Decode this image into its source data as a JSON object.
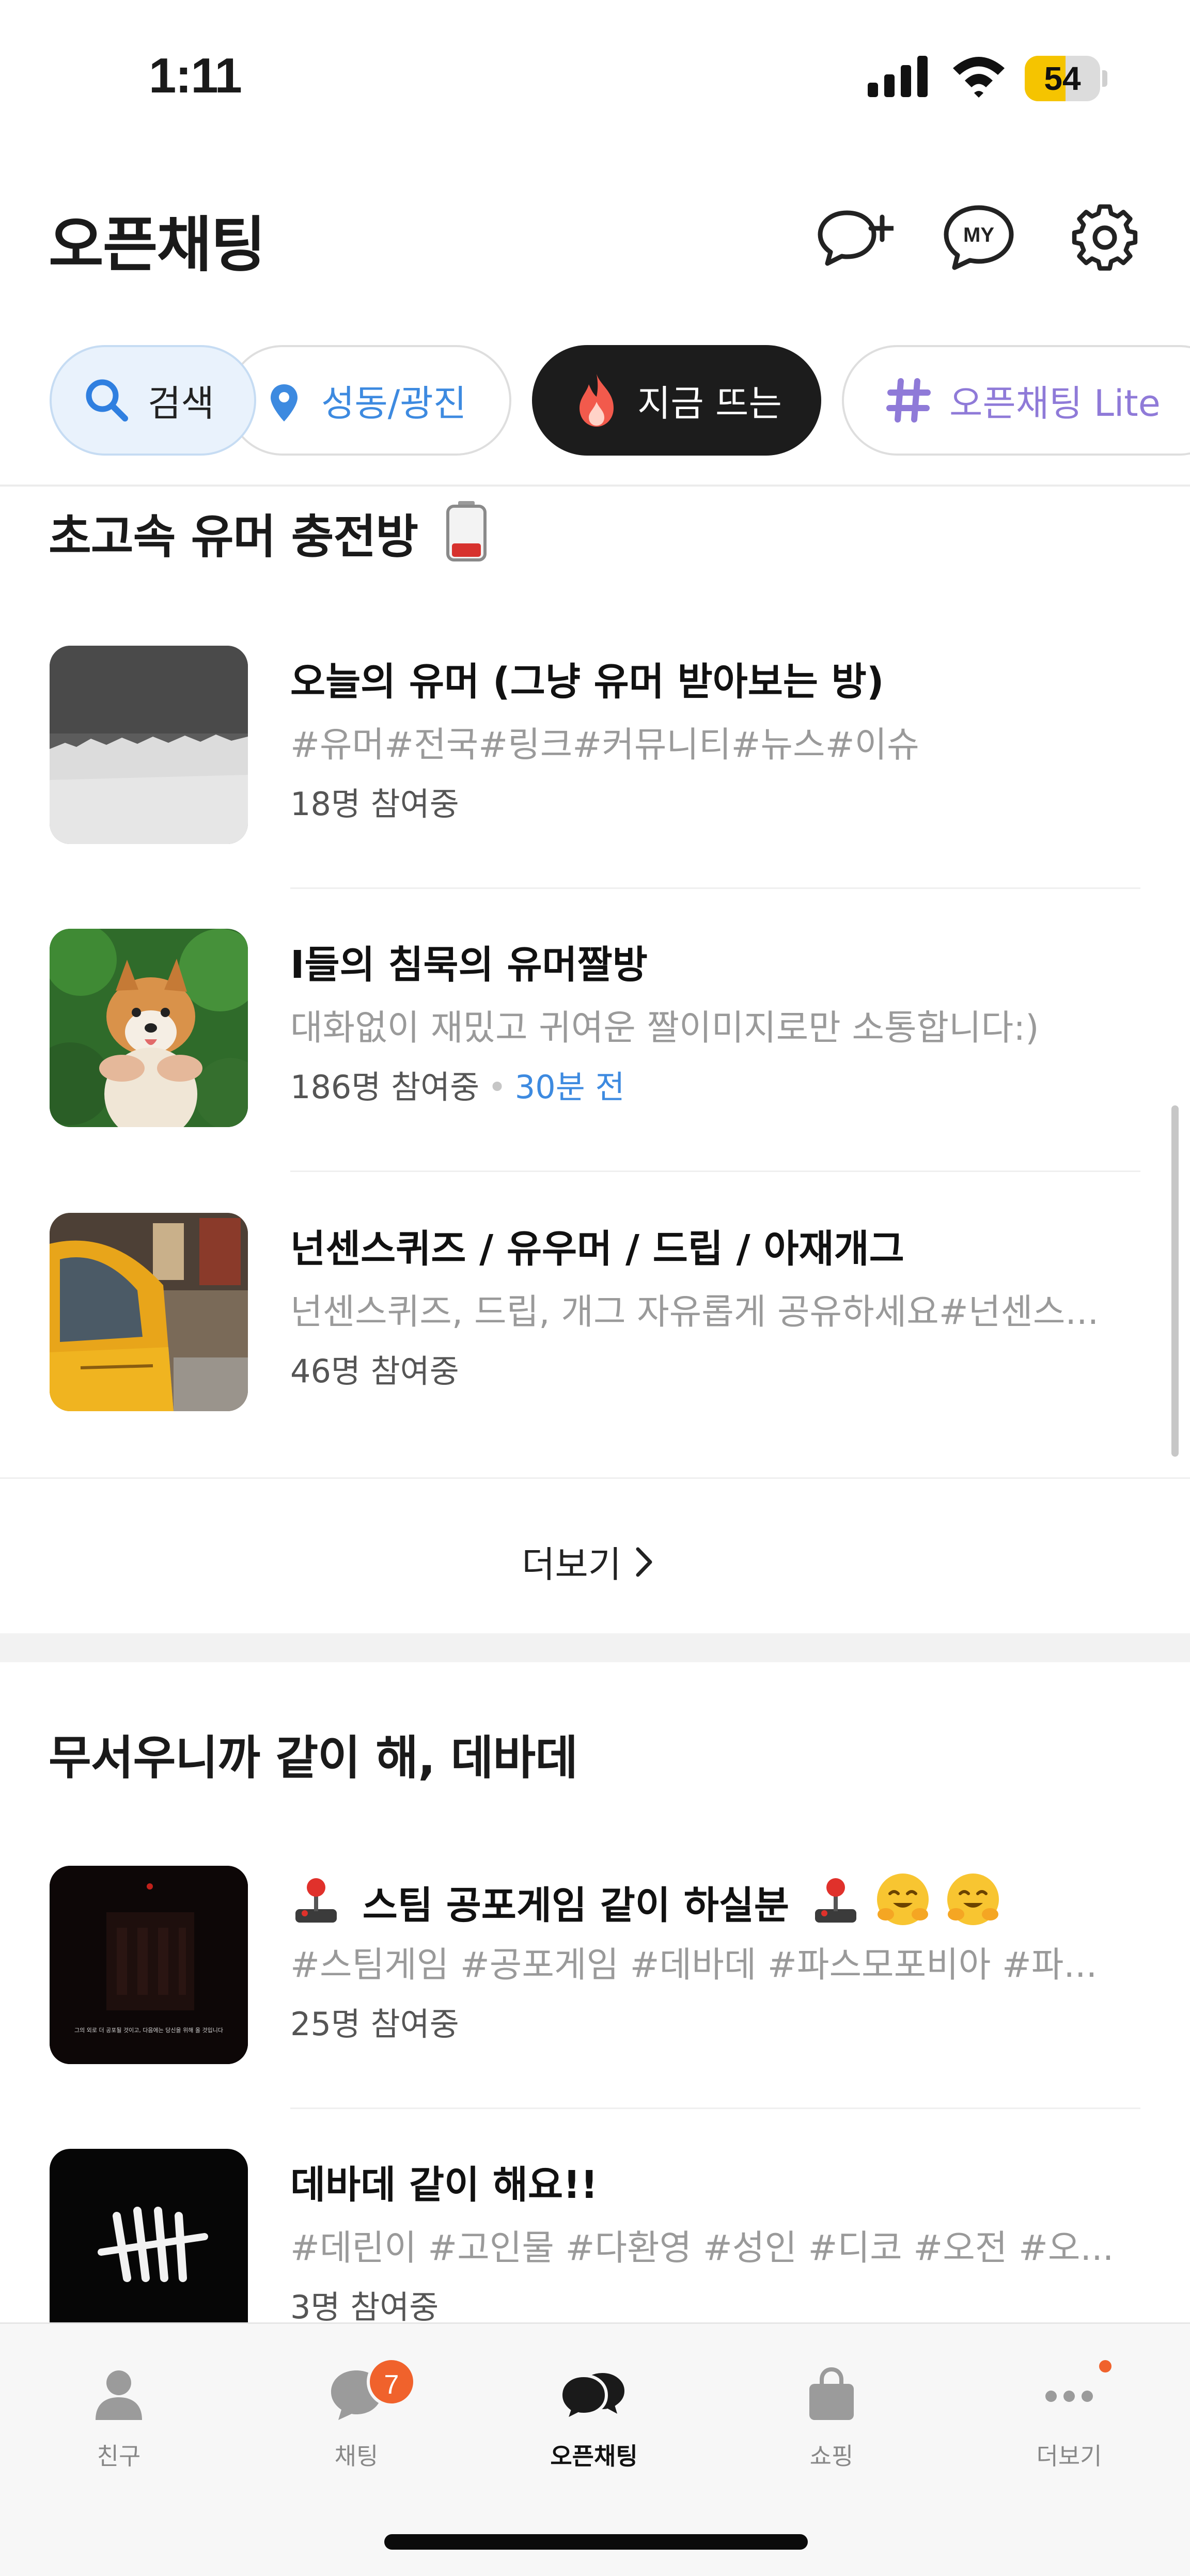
{
  "status_bar": {
    "time": "1:11",
    "battery": "54",
    "battery_level": 0.54
  },
  "header": {
    "title": "오픈채팅"
  },
  "filters": [
    {
      "label": "검색"
    },
    {
      "label": "성동/광진"
    },
    {
      "label": "지금 뜨는"
    },
    {
      "label": "오픈채팅 Lite"
    }
  ],
  "section1": {
    "title": "초고속 유머 충전방",
    "rooms": [
      {
        "title": "오늘의 유머 (그냥 유머 받아보는 방)",
        "desc": "#유머#전국#링크#커뮤니티#뉴스#이슈",
        "members": "18명 참여중",
        "time": ""
      },
      {
        "title": "I들의 침묵의 유머짤방",
        "desc": "대화없이 재밌고 귀여운 짤이미지로만 소통합니다:)",
        "members": "186명 참여중",
        "time": "30분 전"
      },
      {
        "title": "넌센스퀴즈 / 유우머 / 드립 / 아재개그",
        "desc": "넌센스퀴즈, 드립, 개그 자유롭게 공유하세요#넌센스...",
        "members": "46명 참여중",
        "time": ""
      }
    ],
    "more": "더보기"
  },
  "section2": {
    "title": "무서우니까 같이 해, 데바데",
    "rooms": [
      {
        "title": "스팀 공포게임 같이 하실분",
        "desc": "#스팀게임 #공포게임 #데바데 #파스모포비아 #파...",
        "members": "25명 참여중",
        "thumb_caption": "그의 외로 더 공포될 것이고, 다음에는 당신을 위해 올 것입니다"
      },
      {
        "title": "데바데 같이 해요!!",
        "desc": "#데린이 #고인물 #다환영 #성인 #디코 #오전 #오...",
        "members": "3명 참여중"
      }
    ]
  },
  "nav": [
    {
      "label": "친구"
    },
    {
      "label": "채팅",
      "badge": "7"
    },
    {
      "label": "오픈채팅"
    },
    {
      "label": "쇼핑"
    },
    {
      "label": "더보기"
    }
  ],
  "colors": {
    "accent_blue": "#3d8ae0",
    "badge_orange": "#f0622c",
    "lite_purple": "#8f7ad8",
    "battery_yellow": "#f5c400"
  }
}
